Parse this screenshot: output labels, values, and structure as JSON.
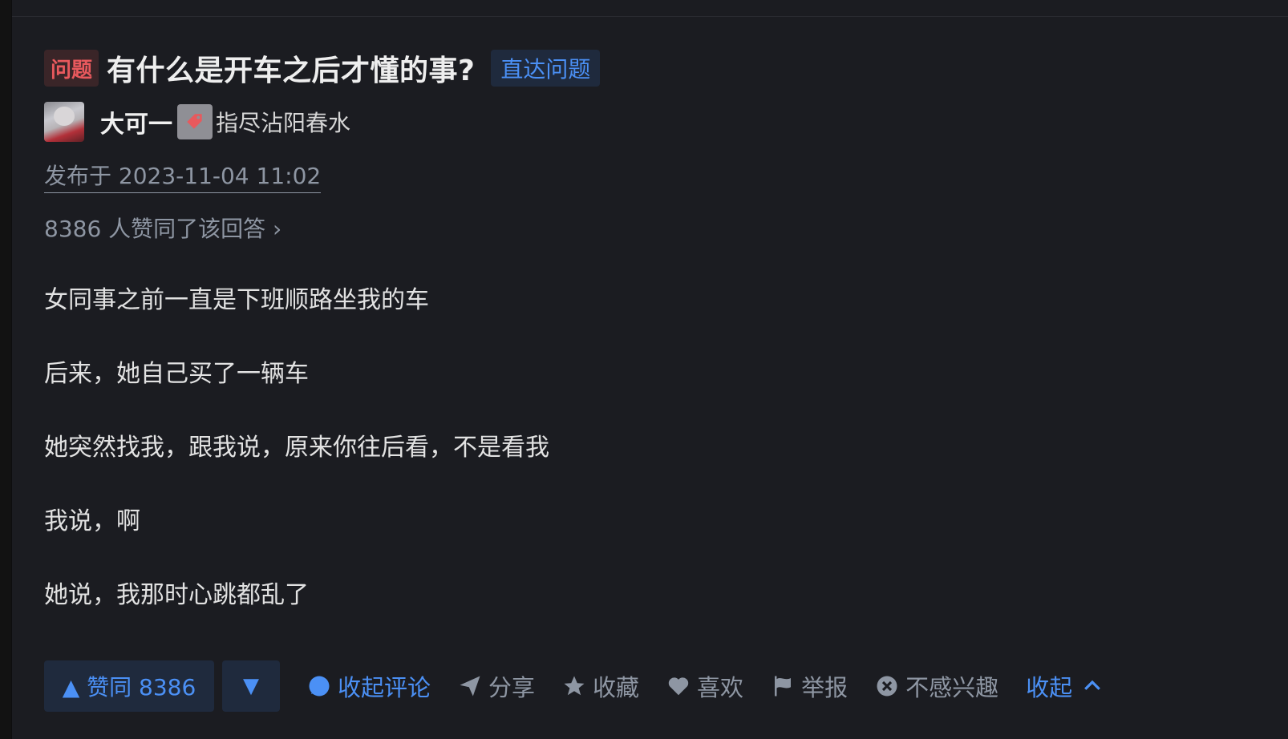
{
  "question": {
    "badge": "问题",
    "title": "有什么是开车之后才懂的事?",
    "goto_label": "直达问题"
  },
  "author": {
    "name": "大可一",
    "bio": "指尽沾阳春水"
  },
  "publish_time": "发布于 2023-11-04 11:02",
  "votes_line": "8386 人赞同了该回答 ›",
  "content": [
    "女同事之前一直是下班顺路坐我的车",
    "后来，她自己买了一辆车",
    "她突然找我，跟我说，原来你往后看，不是看我",
    "我说，啊",
    "她说，我那时心跳都乱了"
  ],
  "actions": {
    "vote_up": "▲ 赞同 8386",
    "vote_down": "▼",
    "comment": "收起评论",
    "share": "分享",
    "collect": "收藏",
    "like": "喜欢",
    "report": "举报",
    "not_interested": "不感兴趣",
    "collapse": "收起"
  },
  "colors": {
    "background": "#1b1c21",
    "accent": "#4b90f5",
    "badge_red": "#e8595d",
    "muted": "#8e96a3"
  },
  "icons": [
    "tag-icon",
    "comment-bubble-icon",
    "paper-plane-icon",
    "star-icon",
    "heart-icon",
    "flag-icon",
    "close-circle-icon",
    "chevron-up-icon"
  ]
}
